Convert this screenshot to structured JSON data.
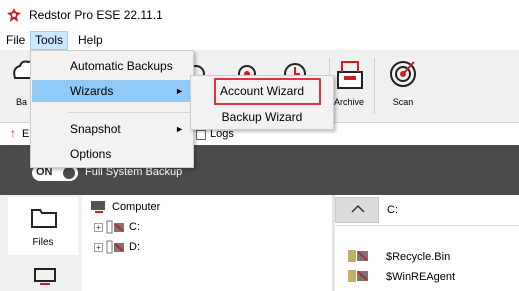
{
  "window": {
    "title": "Redstor Pro ESE 22.11.1"
  },
  "menubar": {
    "file": "File",
    "tools": "Tools",
    "help": "Help"
  },
  "toolbar": {
    "backups_label_partial": "Ba",
    "archive_label": "Archive",
    "scan_label": "Scan"
  },
  "tabs": {
    "partial_e": "E",
    "logs": "Logs"
  },
  "backup_bar": {
    "toggle_label": "ON",
    "set_name": "Full System Backup"
  },
  "leftnav": {
    "files_label": "Files"
  },
  "tree": {
    "root": "Computer",
    "drives": [
      "C:",
      "D:"
    ]
  },
  "rightpane": {
    "path": "C:",
    "files": [
      "$Recycle.Bin",
      "$WinREAgent"
    ]
  },
  "tools_menu": {
    "items": [
      "Automatic Backups",
      "Wizards",
      "Snapshot",
      "Options"
    ]
  },
  "wizards_submenu": {
    "items": [
      "Account Wizard",
      "Backup Wizard"
    ]
  },
  "colors": {
    "brand": "#c8202a",
    "highlight": "#d9393c",
    "menu_hover": "#91c9f7"
  }
}
